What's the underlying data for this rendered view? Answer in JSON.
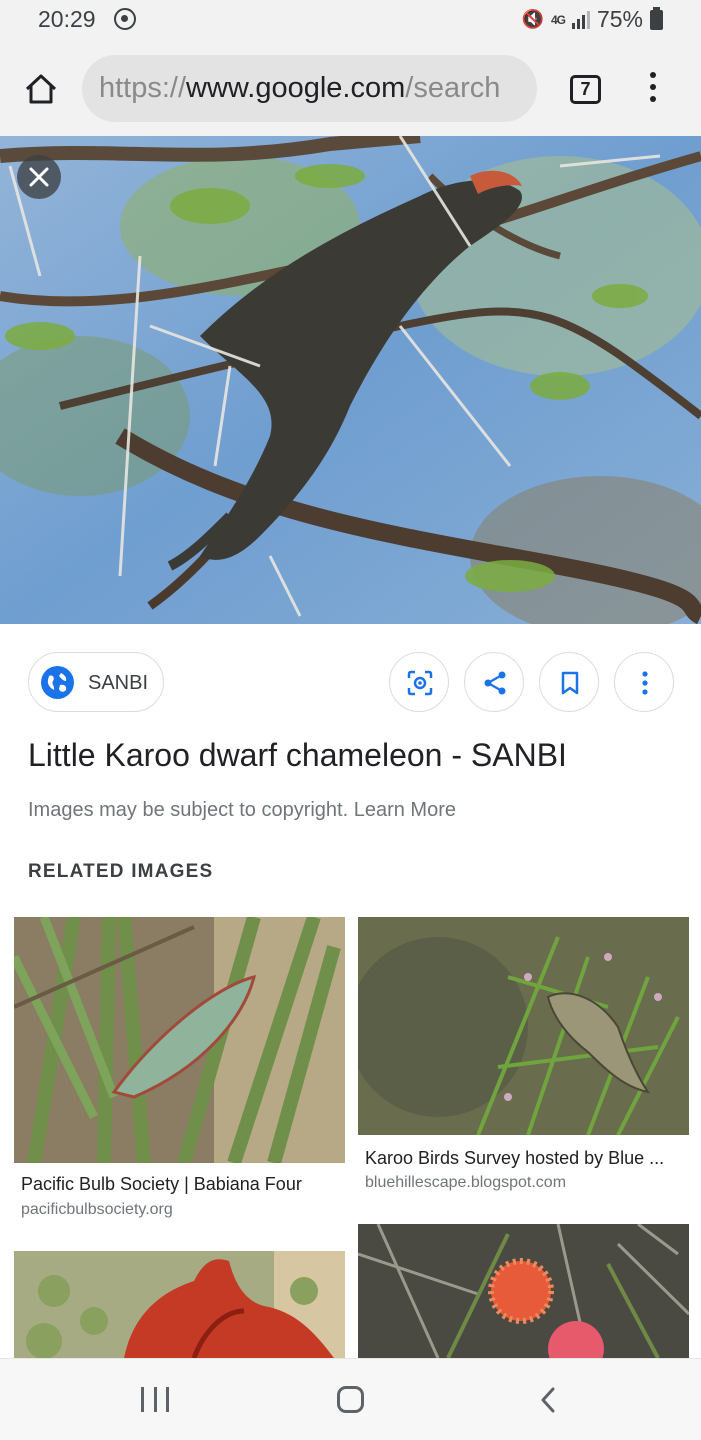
{
  "status_bar": {
    "time": "20:29",
    "network": "4G",
    "battery": "75%",
    "icons": [
      "whatsapp-icon",
      "mute-icon",
      "network-icon",
      "signal-icon",
      "battery-icon"
    ]
  },
  "toolbar": {
    "url_scheme": "https://",
    "url_host": "www.google.com",
    "url_path": "/search",
    "tab_count": "7",
    "icons": [
      "home-icon",
      "more-vert-icon"
    ]
  },
  "image_viewer": {
    "close_icon": "close-icon",
    "source_label": "SANBI",
    "title": "Little Karoo dwarf chameleon - SANBI",
    "copyright_text": "Images may be subject to copyright. Learn More",
    "action_icons": [
      "lens-icon",
      "share-icon",
      "bookmark-icon",
      "more-vert-icon"
    ]
  },
  "related": {
    "heading": "RELATED IMAGES",
    "items": [
      {
        "caption": "Pacific Bulb Society | Babiana Four",
        "domain": "pacificbulbsociety.org"
      },
      {
        "caption": "Karoo Birds Survey hosted by Blue ...",
        "domain": "bluehillescape.blogspot.com"
      },
      {
        "caption": "",
        "domain": ""
      },
      {
        "caption": "",
        "domain": ""
      }
    ]
  },
  "nav_bar": {
    "icons": [
      "recent-apps-icon",
      "home-circle-icon",
      "back-icon"
    ]
  },
  "colors": {
    "accent_blue": "#1a73e8",
    "text_primary": "#202124",
    "text_secondary": "#70757a",
    "chrome_bg": "#f2f2f2"
  }
}
